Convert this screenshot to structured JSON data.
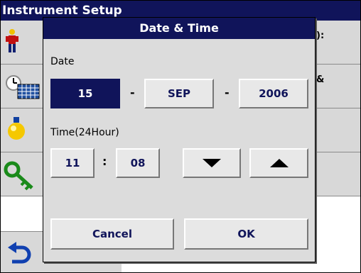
{
  "background": {
    "title": "Instrument Setup",
    "rows": [
      {
        "label": "):"
      },
      {
        "label": "&"
      }
    ],
    "icons": [
      "operator-id-icon",
      "date-time-icon",
      "lamp-icon",
      "password-key-icon",
      "back-arrow-icon"
    ]
  },
  "dialog": {
    "title": "Date & Time",
    "date_label": "Date",
    "day": "15",
    "month": "SEP",
    "year": "2006",
    "date_separator": "-",
    "time_label": "Time(24Hour)",
    "hour": "11",
    "minute": "08",
    "time_separator": ":",
    "cancel_label": "Cancel",
    "ok_label": "OK"
  },
  "colors": {
    "title_bar": "#10145a",
    "selected_field": "#10145a",
    "panel": "#dcdcdc"
  }
}
